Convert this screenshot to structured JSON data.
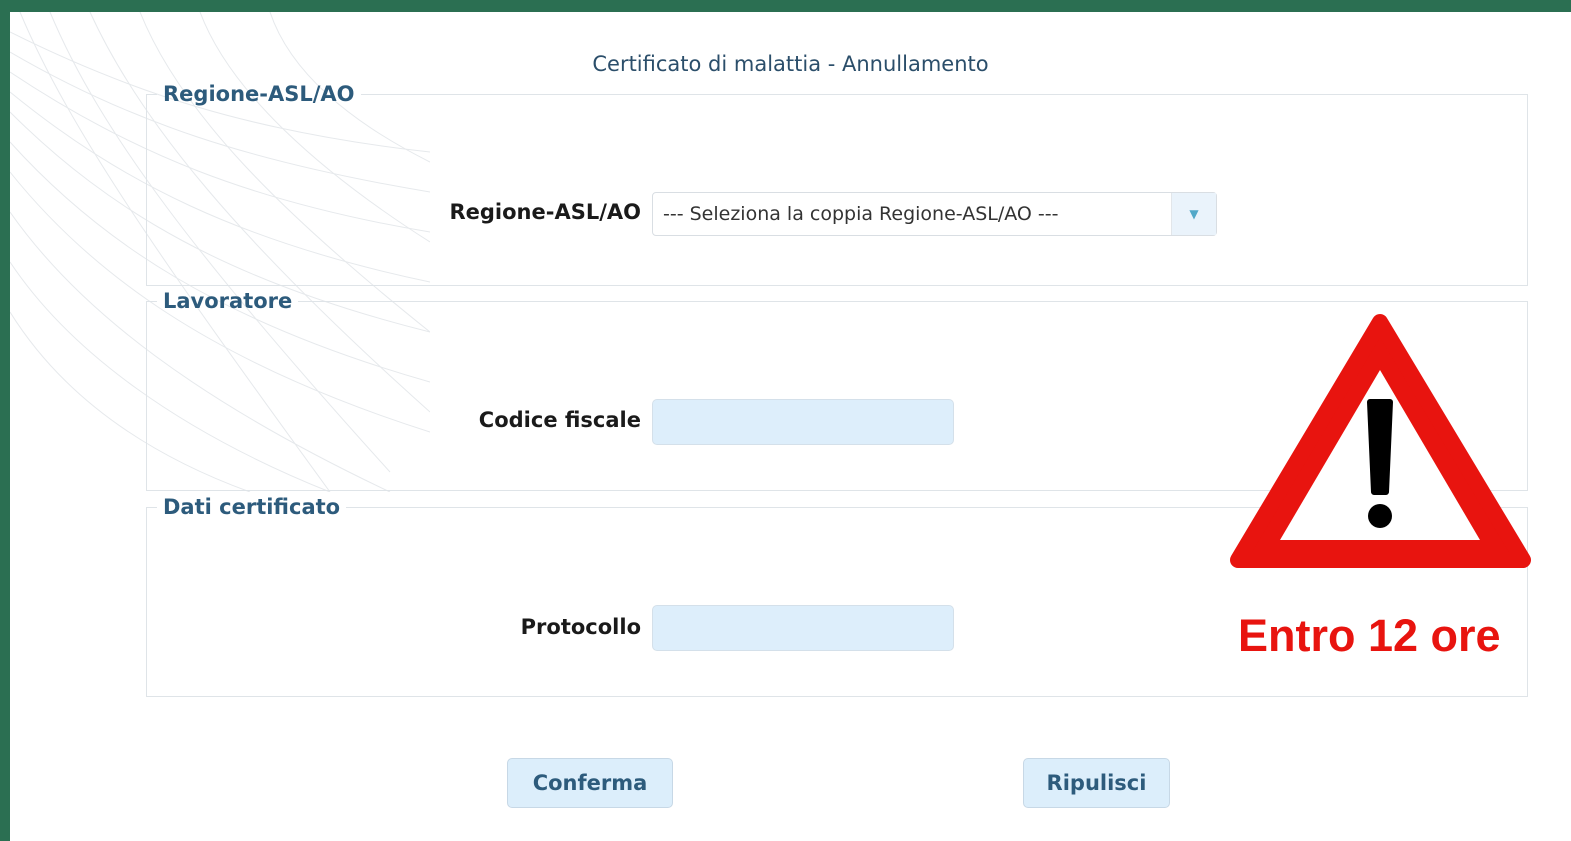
{
  "page": {
    "title": "Certificato di malattia - Annullamento"
  },
  "sections": {
    "regione": {
      "legend": "Regione-ASL/AO",
      "field_label": "Regione-ASL/AO",
      "select_value": "--- Seleziona la coppia Regione-ASL/AO ---"
    },
    "lavoratore": {
      "legend": "Lavoratore",
      "field_label": "Codice fiscale",
      "field_value": ""
    },
    "dati_certificato": {
      "legend": "Dati certificato",
      "field_label": "Protocollo",
      "field_value": ""
    }
  },
  "buttons": {
    "confirm_label": "Conferma",
    "reset_label": "Ripulisci"
  },
  "warning": {
    "icon": "warning-triangle-icon",
    "text": "Entro 12 ore",
    "color": "#e8140f"
  },
  "colors": {
    "outer_border": "#2b6f52",
    "legend": "#2d5b7c",
    "input_fill": "#ddeefb"
  }
}
